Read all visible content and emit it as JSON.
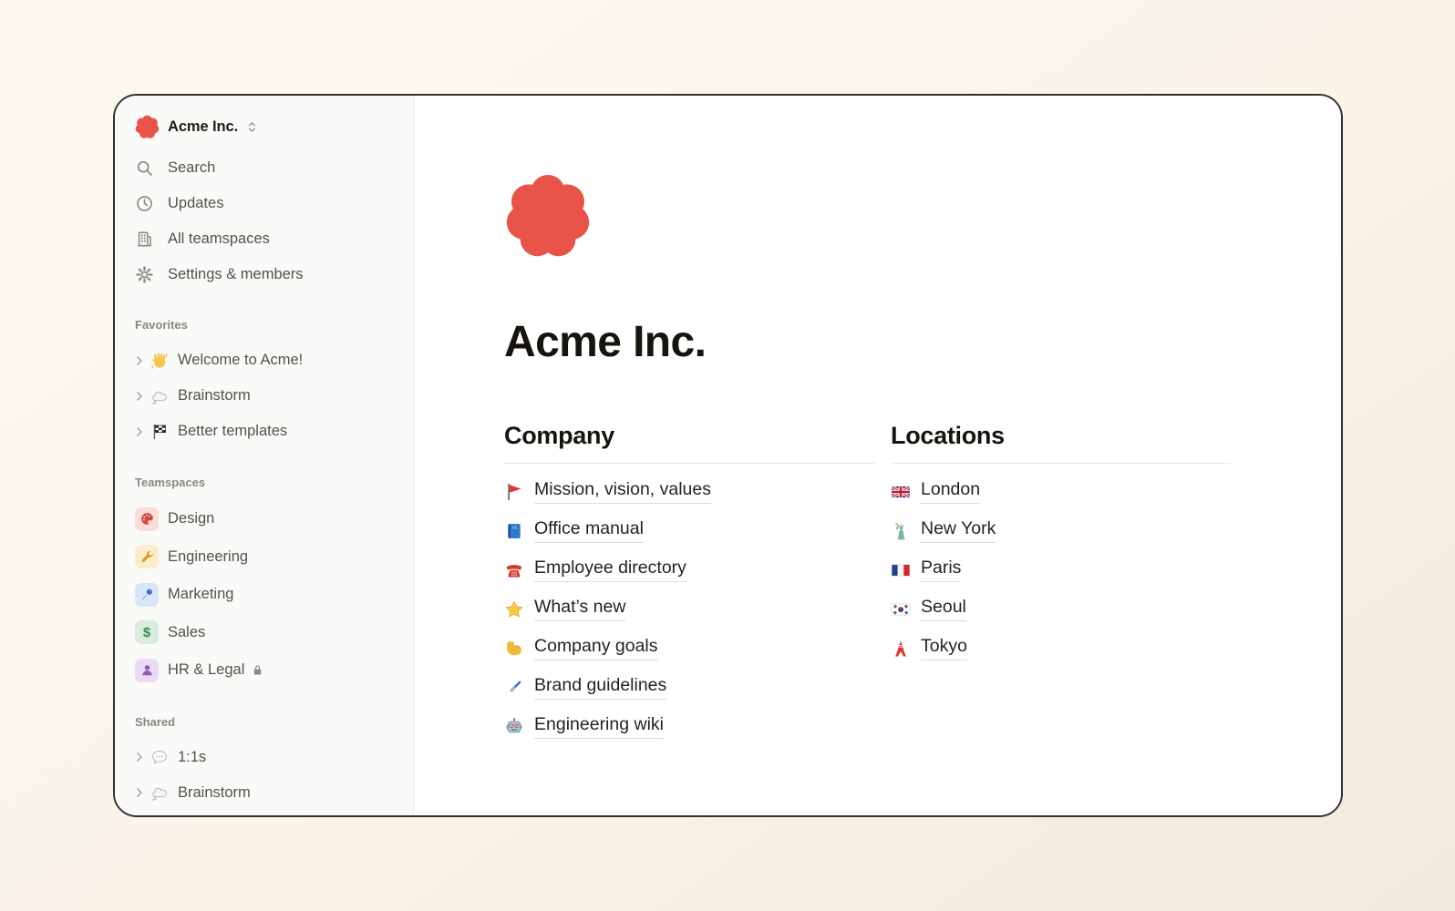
{
  "colors": {
    "accent_red": "#e8544a",
    "canvas_background": "#faf4e9",
    "window_background": "#ffffff",
    "sidebar_background": "#fafaf8",
    "sidebar_text": "#54524c",
    "link_text": "#26231c",
    "heading_text": "#17140e"
  },
  "workspace": {
    "name": "Acme Inc.",
    "logo_icon": "acme-logo-blob",
    "switcher_icon": "workspace-switcher-icon"
  },
  "sidebar": {
    "nav": {
      "items": [
        {
          "label": "Search",
          "icon": "search-icon"
        },
        {
          "label": "Updates",
          "icon": "clock-icon"
        },
        {
          "label": "All teamspaces",
          "icon": "building-icon"
        },
        {
          "label": "Settings & members",
          "icon": "gear-icon"
        }
      ]
    },
    "favorites": {
      "title": "Favorites",
      "items": [
        {
          "label": "Welcome to Acme!",
          "icon": "wave-icon",
          "expand_icon": "chevron-right-icon"
        },
        {
          "label": "Brainstorm",
          "icon": "thought-cloud-icon",
          "expand_icon": "chevron-right-icon"
        },
        {
          "label": "Better templates",
          "icon": "checkered-flag-icon",
          "expand_icon": "chevron-right-icon"
        }
      ]
    },
    "teamspaces": {
      "title": "Teamspaces",
      "items": [
        {
          "label": "Design",
          "icon": "palette-icon"
        },
        {
          "label": "Engineering",
          "icon": "wrench-icon"
        },
        {
          "label": "Marketing",
          "icon": "push-pin-icon"
        },
        {
          "label": "Sales",
          "icon": "dollar-icon"
        },
        {
          "label": "HR & Legal",
          "icon": "person-icon",
          "suffix_icon": "lock-icon"
        }
      ]
    },
    "shared": {
      "title": "Shared",
      "items": [
        {
          "label": "1:1s",
          "icon": "speech-bubble-icon",
          "expand_icon": "chevron-right-icon"
        },
        {
          "label": "Brainstorm",
          "icon": "thought-cloud-icon",
          "expand_icon": "chevron-right-icon"
        }
      ]
    }
  },
  "main": {
    "page_icon": "acme-logo-blob",
    "page_title": "Acme Inc.",
    "columns": [
      {
        "title": "Company",
        "items": [
          {
            "label": "Mission, vision, values",
            "icon": "flag-icon"
          },
          {
            "label": "Office manual",
            "icon": "blue-book-icon"
          },
          {
            "label": "Employee directory",
            "icon": "red-phone-icon"
          },
          {
            "label": "What’s new",
            "icon": "star-icon"
          },
          {
            "label": "Company goals",
            "icon": "flexed-biceps-icon"
          },
          {
            "label": "Brand guidelines",
            "icon": "paintbrush-icon"
          },
          {
            "label": "Engineering wiki",
            "icon": "robot-icon"
          }
        ]
      },
      {
        "title": "Locations",
        "items": [
          {
            "label": "London",
            "icon": "uk-flag-icon"
          },
          {
            "label": "New York",
            "icon": "statue-of-liberty-icon"
          },
          {
            "label": "Paris",
            "icon": "france-flag-icon"
          },
          {
            "label": "Seoul",
            "icon": "south-korea-flag-icon"
          },
          {
            "label": "Tokyo",
            "icon": "tokyo-tower-icon"
          }
        ]
      }
    ]
  }
}
